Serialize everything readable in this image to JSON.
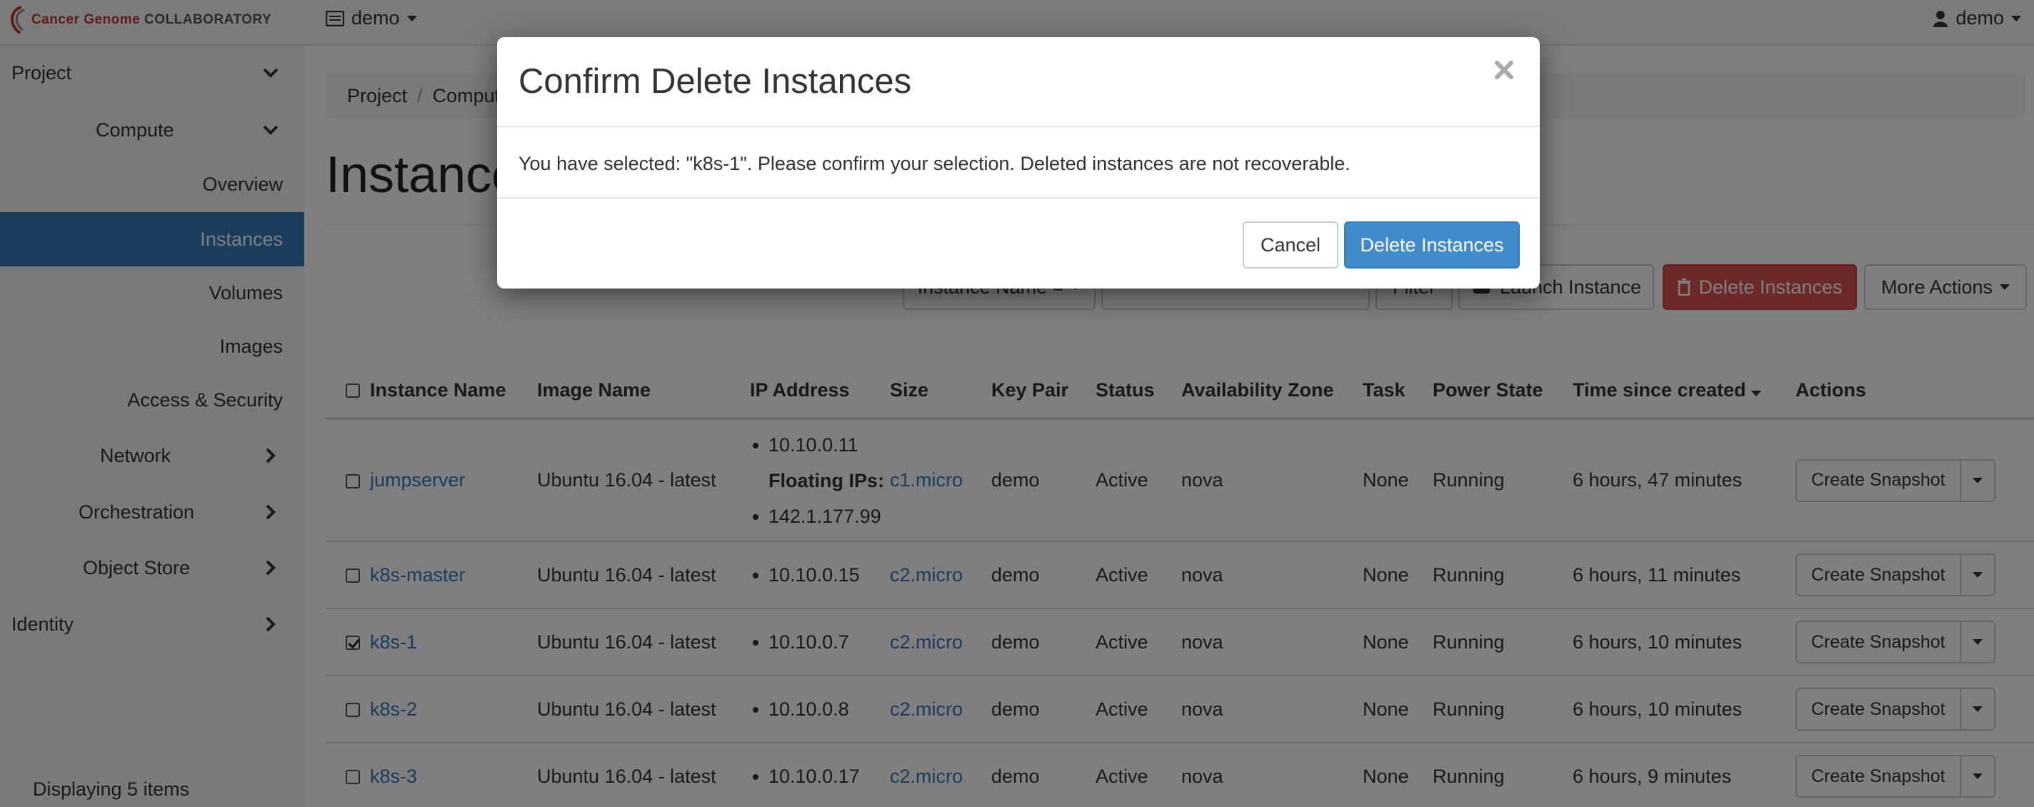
{
  "brand": {
    "red": "Cancer Genome",
    "gray": "COLLABORATORY"
  },
  "header": {
    "project": "demo",
    "user": "demo"
  },
  "sidebar": {
    "project": "Project",
    "compute": "Compute",
    "items": [
      "Overview",
      "Instances",
      "Volumes",
      "Images",
      "Access & Security"
    ],
    "network": "Network",
    "orchestration": "Orchestration",
    "object_store": "Object Store",
    "identity": "Identity"
  },
  "breadcrumb": {
    "project": "Project",
    "sep": "/",
    "current": "Compute"
  },
  "page_title": "Instances",
  "toolbar": {
    "filter_field": "Instance Name =",
    "filter": "Filter",
    "launch": "Launch Instance",
    "delete": "Delete Instances",
    "more": "More Actions"
  },
  "table": {
    "headers": [
      "Instance Name",
      "Image Name",
      "IP Address",
      "Size",
      "Key Pair",
      "Status",
      "Availability Zone",
      "Task",
      "Power State",
      "Time since created",
      "Actions"
    ],
    "rows": [
      {
        "checked": false,
        "name": "jumpserver",
        "image": "Ubuntu 16.04 - latest",
        "ip": "10.10.0.11",
        "floating_label": "Floating IPs:",
        "floating_ip": "142.1.177.99",
        "size": "c1.micro",
        "key": "demo",
        "status": "Active",
        "zone": "nova",
        "task": "None",
        "power": "Running",
        "created": "6 hours, 47 minutes",
        "action": "Create Snapshot"
      },
      {
        "checked": false,
        "name": "k8s-master",
        "image": "Ubuntu 16.04 - latest",
        "ip": "10.10.0.15",
        "size": "c2.micro",
        "key": "demo",
        "status": "Active",
        "zone": "nova",
        "task": "None",
        "power": "Running",
        "created": "6 hours, 11 minutes",
        "action": "Create Snapshot"
      },
      {
        "checked": true,
        "name": "k8s-1",
        "image": "Ubuntu 16.04 - latest",
        "ip": "10.10.0.7",
        "size": "c2.micro",
        "key": "demo",
        "status": "Active",
        "zone": "nova",
        "task": "None",
        "power": "Running",
        "created": "6 hours, 10 minutes",
        "action": "Create Snapshot"
      },
      {
        "checked": false,
        "name": "k8s-2",
        "image": "Ubuntu 16.04 - latest",
        "ip": "10.10.0.8",
        "size": "c2.micro",
        "key": "demo",
        "status": "Active",
        "zone": "nova",
        "task": "None",
        "power": "Running",
        "created": "6 hours, 10 minutes",
        "action": "Create Snapshot"
      },
      {
        "checked": false,
        "name": "k8s-3",
        "image": "Ubuntu 16.04 - latest",
        "ip": "10.10.0.17",
        "size": "c2.micro",
        "key": "demo",
        "status": "Active",
        "zone": "nova",
        "task": "None",
        "power": "Running",
        "created": "6 hours, 9 minutes",
        "action": "Create Snapshot"
      }
    ],
    "footer": "Displaying 5 items"
  },
  "modal": {
    "title": "Confirm Delete Instances",
    "message": "You have selected: \"k8s-1\". Please confirm your selection. Deleted instances are not recoverable.",
    "cancel": "Cancel",
    "confirm": "Delete Instances"
  },
  "colors": {
    "accent": "#337ab7",
    "danger": "#d9534f",
    "primary_button": "#428bca"
  }
}
